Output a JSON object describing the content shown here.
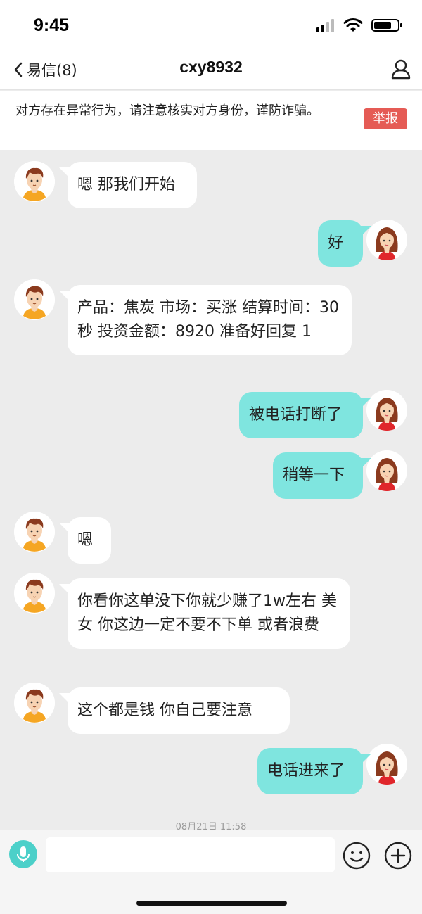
{
  "status_bar": {
    "time": "9:45"
  },
  "nav": {
    "back_label": "易信(8)",
    "title": "cxy8932"
  },
  "warning": {
    "text": "对方存在异常行为，请注意核实对方身份，谨防诈骗。",
    "report_label": "举报"
  },
  "messages": [
    {
      "sender": "other",
      "text": "嗯 那我们开始"
    },
    {
      "sender": "me",
      "text": "好"
    },
    {
      "sender": "other",
      "text": "产品：焦炭 市场：买涨 结算时间：30秒 投资金额：8920 准备好回复 1"
    },
    {
      "sender": "me",
      "text": "被电话打断了"
    },
    {
      "sender": "me",
      "text": "稍等一下"
    },
    {
      "sender": "other",
      "text": "嗯"
    },
    {
      "sender": "other",
      "text": "你看你这单没下你就少赚了1w左右 美女 你这边一定不要不下单 或者浪费"
    },
    {
      "sender": "other",
      "text": "这个都是钱  你自己要注意"
    },
    {
      "sender": "me",
      "text": "电话进来了"
    }
  ],
  "timestamp": "08月21日 11:58",
  "input": {
    "value": "",
    "placeholder": ""
  },
  "icons": {
    "back": "chevron-left-icon",
    "profile": "person-icon",
    "voice": "microphone-icon",
    "emoji": "smiley-icon",
    "plus": "plus-icon"
  },
  "colors": {
    "outgoing_bubble": "#7fe5df",
    "incoming_bubble": "#ffffff",
    "report": "#e55b55",
    "voice": "#4cd0c9"
  }
}
